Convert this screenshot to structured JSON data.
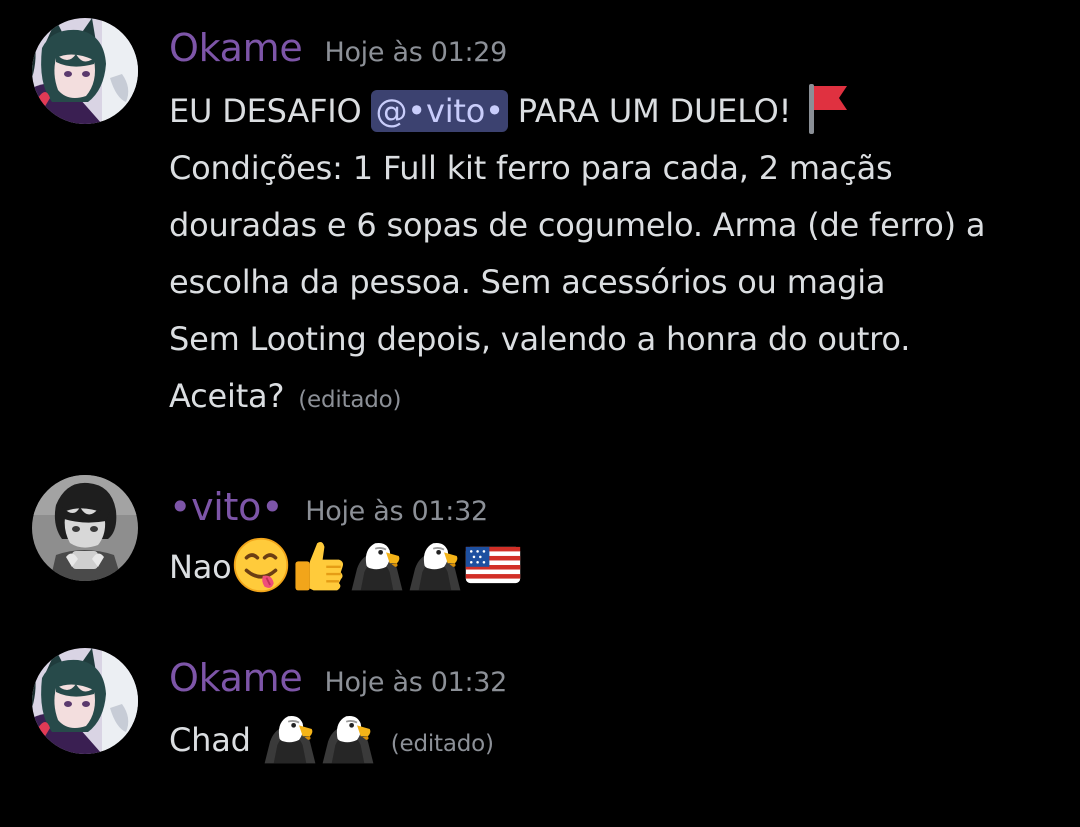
{
  "colors": {
    "background": "#000000",
    "okame_name": "#7d55a8",
    "vito_name": "#7d55a8",
    "text": "#dbdee1",
    "timestamp": "#8c9097",
    "mention_bg": "#3c4270",
    "mention_text": "#c9cdfb"
  },
  "messages": [
    {
      "username": "Okame",
      "timestamp": "Hoje às 01:29",
      "line1_before": "EU DESAFIO ",
      "mention": "@•vito•",
      "line1_after": " PARA UM DUELO!",
      "line1_emoji": "red-flag-emoji",
      "lines": [
        "Condições: 1 Full kit ferro para cada, 2 maçãs",
        "douradas e 6 sopas de cogumelo. Arma (de ferro) a",
        "escolha da pessoa. Sem acessórios ou magia",
        "Sem Looting depois, valendo a honra do outro."
      ],
      "last_line": "Aceita?",
      "edited": "(editado)"
    },
    {
      "username": "•vito•",
      "timestamp": "Hoje às 01:32",
      "text": "Nao",
      "emojis": [
        "yum-emoji",
        "thumbs-up-emoji",
        "eagle-emoji",
        "eagle-emoji",
        "us-flag-emoji"
      ]
    },
    {
      "username": "Okame",
      "timestamp": "Hoje às 01:32",
      "text": "Chad",
      "emojis": [
        "eagle-emoji",
        "eagle-emoji"
      ],
      "edited": "(editado)"
    }
  ]
}
